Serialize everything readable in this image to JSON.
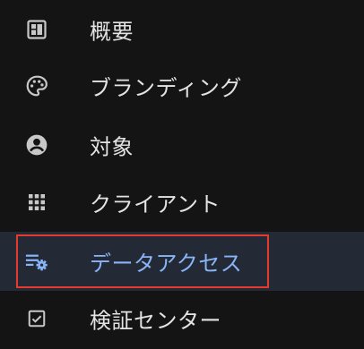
{
  "nav": {
    "items": [
      {
        "label": "概要",
        "icon": "dashboard-icon",
        "active": false
      },
      {
        "label": "ブランディング",
        "icon": "palette-icon",
        "active": false
      },
      {
        "label": "対象",
        "icon": "account-circle-icon",
        "active": false
      },
      {
        "label": "クライアント",
        "icon": "apps-grid-icon",
        "active": false
      },
      {
        "label": "データアクセス",
        "icon": "list-settings-icon",
        "active": true
      },
      {
        "label": "検証センター",
        "icon": "checkbox-icon",
        "active": false
      }
    ]
  },
  "colors": {
    "background": "#141414",
    "text": "#e3e3e3",
    "active_text": "#8ab4f8",
    "active_background": "#232a35",
    "highlight_border": "#e53b2f"
  }
}
